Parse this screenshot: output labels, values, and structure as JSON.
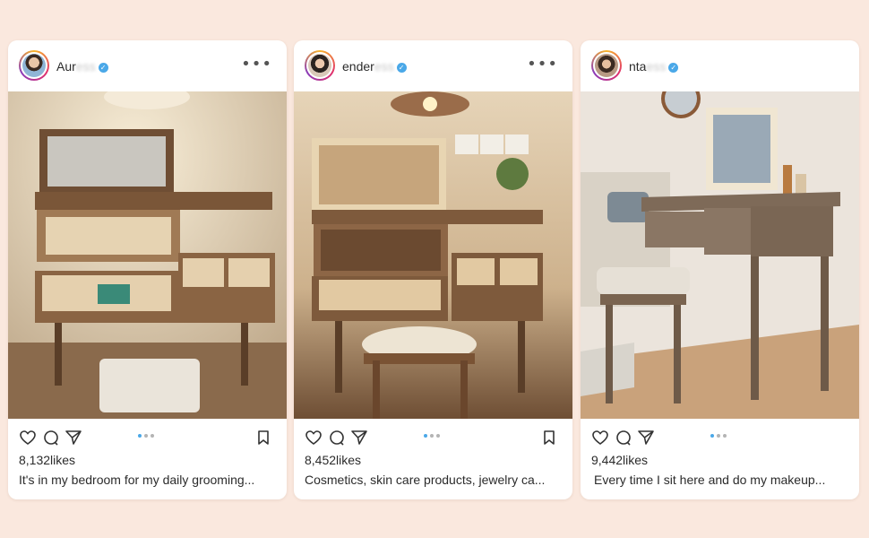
{
  "posts": [
    {
      "username_visible": "Aur",
      "username_blurred": "ess",
      "likes": "8,132likes",
      "caption": "It's in my bedroom for my daily grooming..."
    },
    {
      "username_visible": "ender",
      "username_blurred": "ess",
      "likes": "8,452likes",
      "caption": "Cosmetics, skin care products, jewelry ca..."
    },
    {
      "username_visible": "nta",
      "username_blurred": "ess",
      "likes": "9,442likes",
      "caption": "Every time I sit here and do my makeup..."
    }
  ],
  "icons": {
    "verified": "verified-badge-icon",
    "more": "more-options-icon",
    "like": "heart-icon",
    "comment": "comment-icon",
    "share": "share-icon",
    "save": "bookmark-icon"
  },
  "colors": {
    "background": "#fae8de",
    "card": "#ffffff",
    "accent": "#4aa8e8"
  }
}
